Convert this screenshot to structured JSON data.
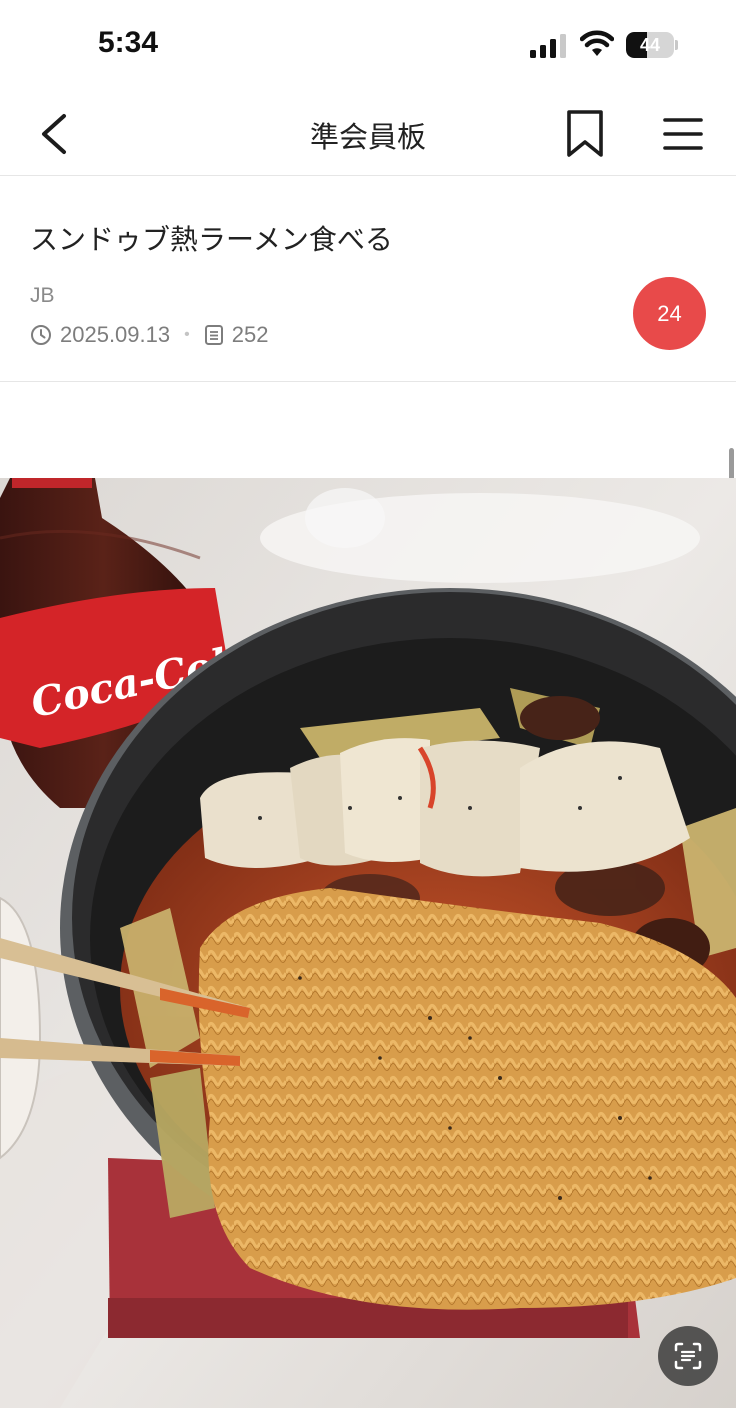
{
  "status_bar": {
    "time": "5:34",
    "battery_level": "44",
    "battery_fraction": 0.44
  },
  "nav": {
    "title": "準会員板",
    "icons": [
      "back-arrow-icon",
      "bookmark-icon",
      "hamburger-menu-icon"
    ]
  },
  "post": {
    "title": "スンドゥブ熱ラーメン食べる",
    "author": "JB",
    "date": "2025.09.13",
    "views": "252",
    "comment_count": "24",
    "icons": [
      "clock-icon",
      "document-icon"
    ]
  },
  "photo": {
    "bottle_label": "Coca-Cola"
  },
  "colors": {
    "badge": "#e84a4a",
    "divider": "#e6e6e6",
    "meta_text": "#7d7d7d"
  }
}
